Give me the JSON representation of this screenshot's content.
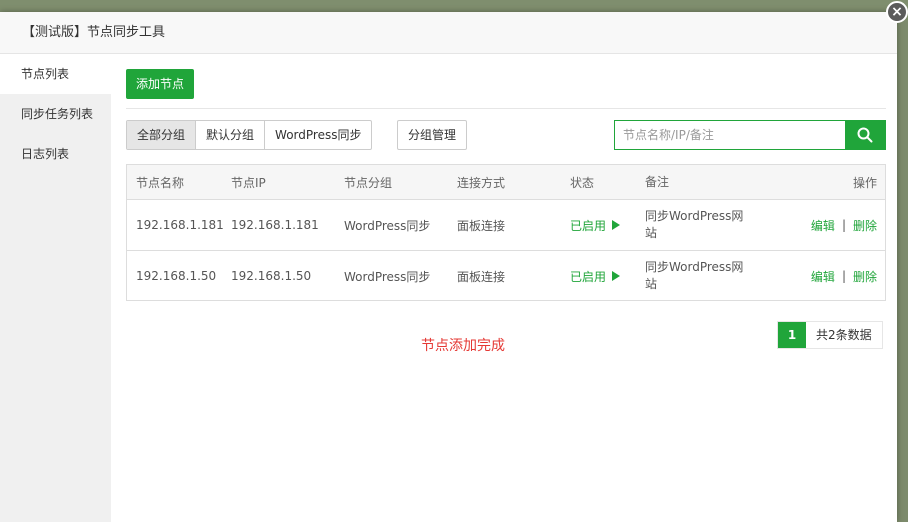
{
  "modal": {
    "title": "【测试版】节点同步工具",
    "close_glyph": "×"
  },
  "sidebar": {
    "items": [
      {
        "label": "节点列表"
      },
      {
        "label": "同步任务列表"
      },
      {
        "label": "日志列表"
      }
    ]
  },
  "toolbar": {
    "add_node_label": "添加节点",
    "group_tabs": [
      {
        "label": "全部分组"
      },
      {
        "label": "默认分组"
      },
      {
        "label": "WordPress同步"
      }
    ],
    "group_manage_label": "分组管理",
    "search_placeholder": "节点名称/IP/备注"
  },
  "table": {
    "columns": [
      "节点名称",
      "节点IP",
      "节点分组",
      "连接方式",
      "状态",
      "备注",
      "操作"
    ],
    "rows": [
      {
        "name": "192.168.1.181",
        "ip": "192.168.1.181",
        "group": "WordPress同步",
        "connection": "面板连接",
        "status": "已启用",
        "remark": "同步WordPress网站"
      },
      {
        "name": "192.168.1.50",
        "ip": "192.168.1.50",
        "group": "WordPress同步",
        "connection": "面板连接",
        "status": "已启用",
        "remark": "同步WordPress网站"
      }
    ],
    "edit_label": "编辑",
    "delete_label": "删除",
    "separator": "|"
  },
  "message": "节点添加完成",
  "pager": {
    "current_page": "1",
    "total_text": "共2条数据"
  },
  "colors": {
    "accent": "#20a53a",
    "message": "#e53935"
  },
  "icons": {
    "close": "close-icon",
    "search": "search-icon",
    "status": "play-icon"
  }
}
